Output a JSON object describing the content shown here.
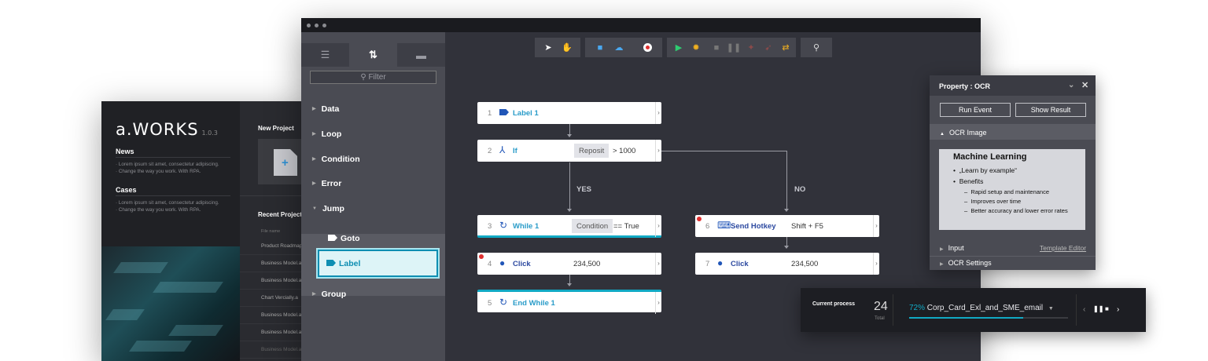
{
  "back_app": {
    "logo": "a.WORKS",
    "version": "1.0.3",
    "news_heading": "News",
    "news_lines": [
      "· Lorem ipsum sit amet, consectetur adipiscing.",
      "· Change the way you work. With RPA."
    ],
    "cases_heading": "Cases",
    "cases_lines": [
      "· Lorem ipsum sit amet, consectetur adipiscing.",
      "· Change the way you work. With RPA."
    ],
    "new_project_label": "New Project",
    "new_project_icon": "+",
    "recent_projects_label": "Recent Projects",
    "file_name_header": "File name",
    "files": [
      "Product Roadmap",
      "Business Model.a",
      "Business Model.a",
      "Chart Vercially.a",
      "Business Model.a",
      "Business Model.a",
      "Business Model.a"
    ]
  },
  "main_app": {
    "tabs": [
      {
        "icon": "list-icon",
        "glyph": "☰"
      },
      {
        "icon": "sort-icon",
        "glyph": "⇅"
      },
      {
        "icon": "folder-icon",
        "glyph": "▬"
      }
    ],
    "filter_placeholder": "Filter",
    "collapse_glyph": "«",
    "tree_items": [
      "Data",
      "Loop",
      "Condition",
      "Error",
      "Jump"
    ],
    "jump_children": [
      "Goto",
      "Label"
    ],
    "tree_group": "Group",
    "toolbar_icons": [
      "pointer-icon",
      "hand-icon",
      "save-icon",
      "upload-cloud-icon",
      "record-icon",
      "play-icon",
      "debug-icon",
      "stop-icon",
      "pause-icon",
      "step-into-icon",
      "step-over-icon",
      "step-out-icon",
      "search-icon"
    ],
    "flow": {
      "nodes": [
        {
          "num": "1",
          "name": "Label 1"
        },
        {
          "num": "2",
          "name": "If",
          "chip": "Reposit",
          "arg": "> 1000"
        },
        {
          "num": "3",
          "name": "While 1",
          "chip": "Condition",
          "arg": "== True"
        },
        {
          "num": "4",
          "name": "Click",
          "arg": "234,500"
        },
        {
          "num": "5",
          "name": "End While 1"
        },
        {
          "num": "6",
          "name": "Send Hotkey",
          "arg": "Shift + F5"
        },
        {
          "num": "7",
          "name": "Click",
          "arg": "234,500"
        }
      ],
      "yes_label": "YES",
      "no_label": "NO"
    }
  },
  "property_panel": {
    "title": "Property : OCR",
    "run_event": "Run Event",
    "show_result": "Show Result",
    "ocr_image_section": "OCR Image",
    "slide": {
      "title": "Machine Learning",
      "bullet1": "„Learn by example“",
      "bullet2": "Benefits",
      "sub1": "Rapid setup and maintenance",
      "sub2": "Improves over time",
      "sub3": "Better accuracy and lower error rates"
    },
    "input_label": "Input",
    "template_editor": "Template Editor",
    "ocr_settings": "OCR Settings"
  },
  "current_process": {
    "label": "Current process",
    "count": "24",
    "total_label": "Total",
    "percent": "72%",
    "progress": 0.72,
    "process_name": "Corp_Card_Exl_and_SME_email"
  },
  "colors": {
    "accent": "#11a9c4",
    "selection": "#0e8eb2",
    "record": "#e03030",
    "play": "#2ecc71"
  }
}
